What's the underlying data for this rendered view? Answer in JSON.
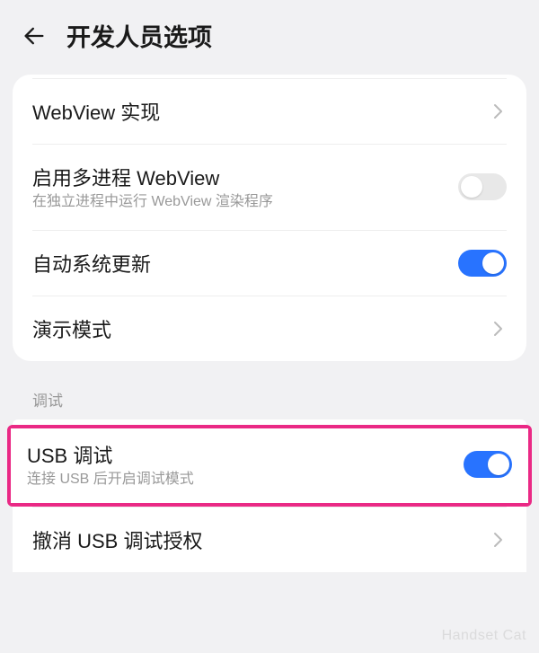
{
  "header": {
    "title": "开发人员选项"
  },
  "section1": {
    "webview_impl": {
      "label": "WebView 实现"
    },
    "multi_process": {
      "label": "启用多进程 WebView",
      "sub": "在独立进程中运行 WebView 渲染程序",
      "enabled": false
    },
    "auto_update": {
      "label": "自动系统更新",
      "enabled": true
    },
    "demo_mode": {
      "label": "演示模式"
    }
  },
  "section2": {
    "header": "调试",
    "usb_debug": {
      "label": "USB 调试",
      "sub": "连接 USB 后开启调试模式",
      "enabled": true
    },
    "revoke_usb": {
      "label": "撤消 USB 调试授权"
    }
  },
  "watermark": "Handset Cat"
}
